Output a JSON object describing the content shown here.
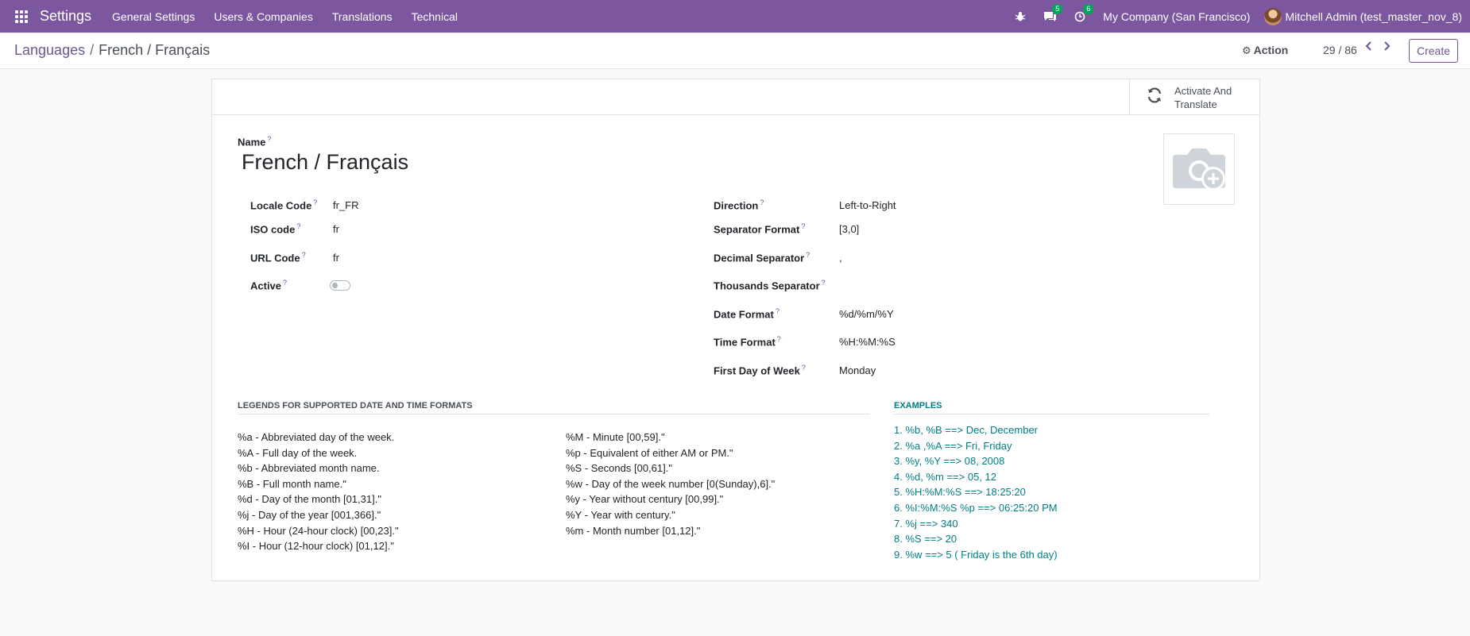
{
  "navbar": {
    "brand": "Settings",
    "menu": [
      "General Settings",
      "Users & Companies",
      "Translations",
      "Technical"
    ],
    "messages_count": "5",
    "activities_count": "6",
    "company": "My Company (San Francisco)",
    "user": "Mitchell Admin (test_master_nov_8)"
  },
  "control": {
    "breadcrumb_parent": "Languages",
    "breadcrumb_current": "French / Français",
    "action_label": "Action",
    "pager": "29 / 86",
    "create_label": "Create"
  },
  "statusbar": {
    "activate_line1": "Activate And",
    "activate_line2": "Translate"
  },
  "form": {
    "name_label": "Name",
    "name_value": "French / Français",
    "left_fields": [
      {
        "label": "Locale Code",
        "value": "fr_FR"
      },
      {
        "label": "ISO code",
        "value": "fr"
      },
      {
        "label": "URL Code",
        "value": "fr"
      },
      {
        "label": "Active",
        "value": ""
      }
    ],
    "active": false,
    "right_fields": [
      {
        "label": "Direction",
        "value": "Left-to-Right"
      },
      {
        "label": "Separator Format",
        "value": "[3,0]"
      },
      {
        "label": "Decimal Separator",
        "value": ","
      },
      {
        "label": "Thousands Separator",
        "value": ""
      },
      {
        "label": "Date Format",
        "value": "%d/%m/%Y"
      },
      {
        "label": "Time Format",
        "value": "%H:%M:%S"
      },
      {
        "label": "First Day of Week",
        "value": "Monday"
      }
    ]
  },
  "legends": {
    "title": "LEGENDS FOR SUPPORTED DATE AND TIME FORMATS",
    "col1": [
      "%a - Abbreviated day of the week.",
      "%A - Full day of the week.",
      "%b - Abbreviated month name.",
      "%B - Full month name.\"",
      "%d - Day of the month [01,31].\"",
      "%j - Day of the year [001,366].\"",
      "%H - Hour (24-hour clock) [00,23].\"",
      "%I - Hour (12-hour clock) [01,12].\""
    ],
    "col2": [
      "%M - Minute [00,59].\"",
      "%p - Equivalent of either AM or PM.\"",
      "%S - Seconds [00,61].\"",
      "%w - Day of the week number [0(Sunday),6].\"",
      "%y - Year without century [00,99].\"",
      "%Y - Year with century.\"",
      "%m - Month number [01,12].\""
    ]
  },
  "examples": {
    "title": "EXAMPLES",
    "items": [
      "1. %b, %B ==> Dec, December",
      "2. %a ,%A ==> Fri, Friday",
      "3. %y, %Y ==> 08, 2008",
      "4. %d, %m ==> 05, 12",
      "5. %H:%M:%S ==> 18:25:20",
      "6. %I:%M:%S %p ==> 06:25:20 PM",
      "7. %j ==> 340",
      "8. %S ==> 20",
      "9. %w ==> 5 ( Friday is the 6th day)"
    ]
  }
}
